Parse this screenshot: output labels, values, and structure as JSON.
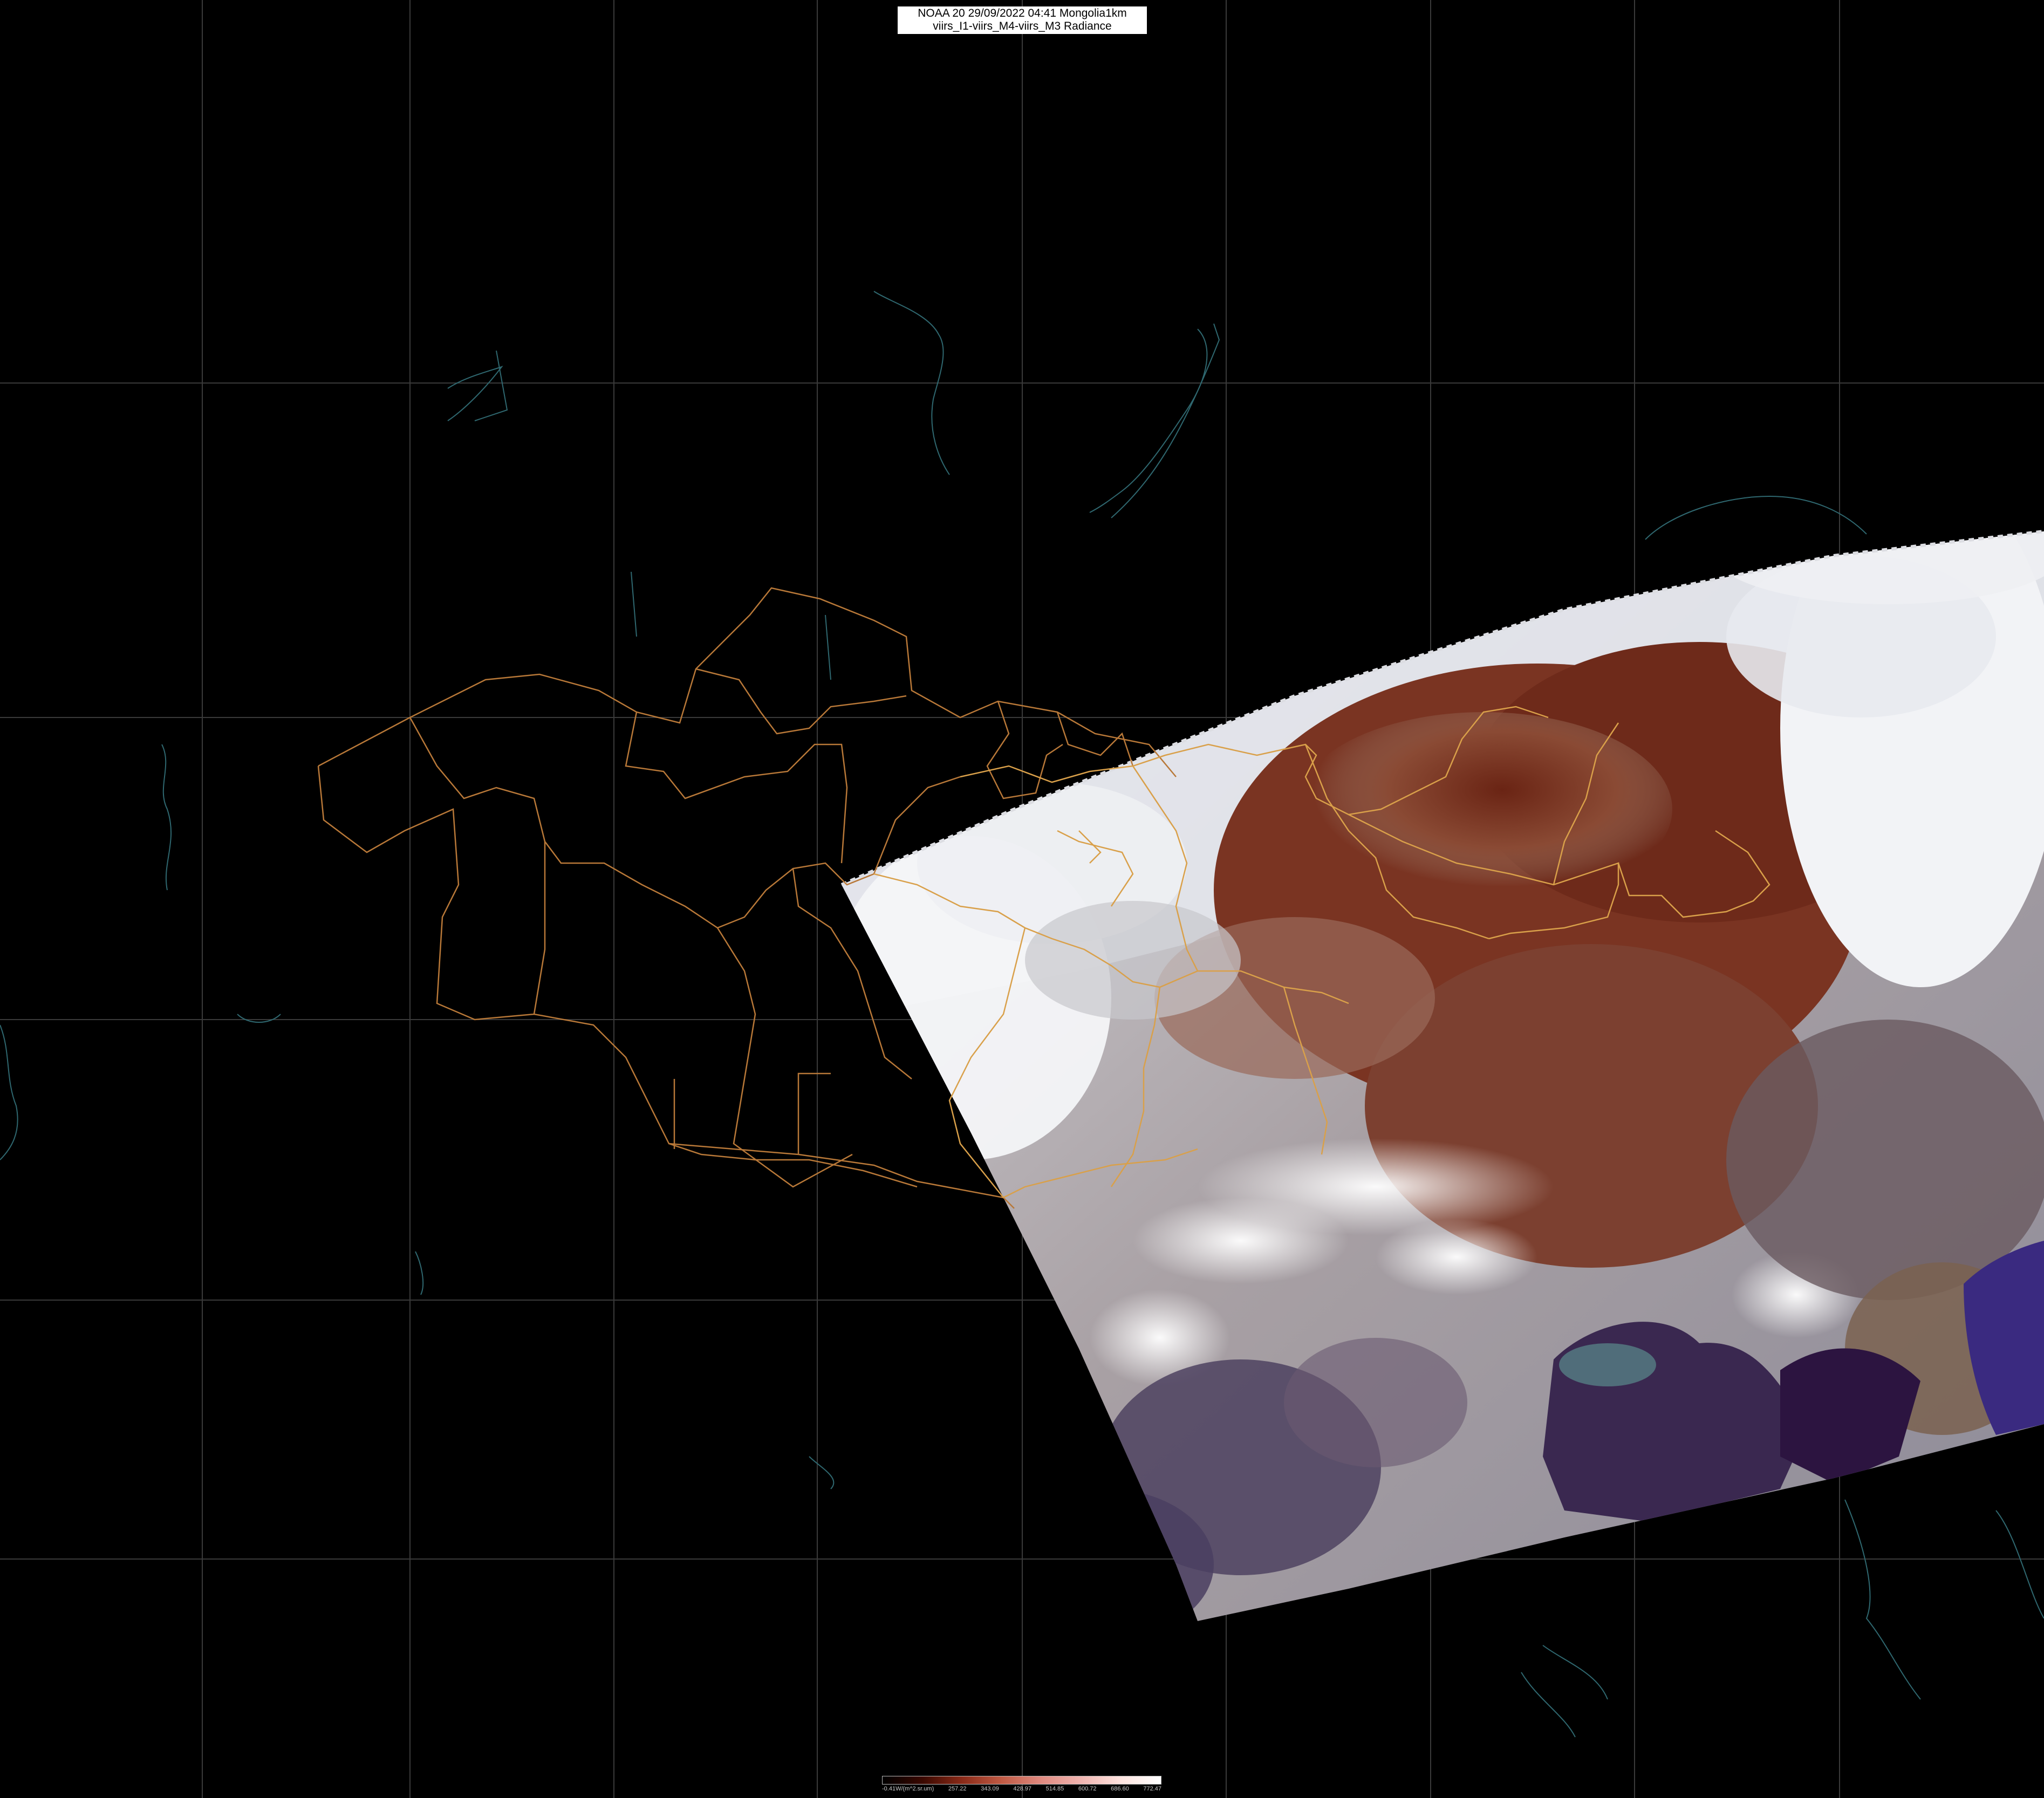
{
  "title": {
    "line1": "NOAA 20 29/09/2022 04:41 Mongolia1km",
    "line2": "viirs_I1-viirs_M4-viirs_M3 Radiance"
  },
  "legend": {
    "labels": [
      "-0.41W/(m^2.sr.um)",
      "257.22",
      "343.09",
      "428.97",
      "514.85",
      "600.72",
      "686.60",
      "772.47"
    ],
    "colors": [
      "#000000",
      "#3a0800",
      "#8a2a18",
      "#c05a44",
      "#e08a80",
      "#f0b4b0",
      "#ffe4e0",
      "#ffffff"
    ]
  },
  "colors": {
    "background": "#000000",
    "graticule": "#3a3a3a",
    "coastline": "#2a5a60",
    "border": "#b87838",
    "land_brown": "#7a3a28",
    "cloud": "#eef0f4",
    "sea_dark": "#2a1040"
  }
}
